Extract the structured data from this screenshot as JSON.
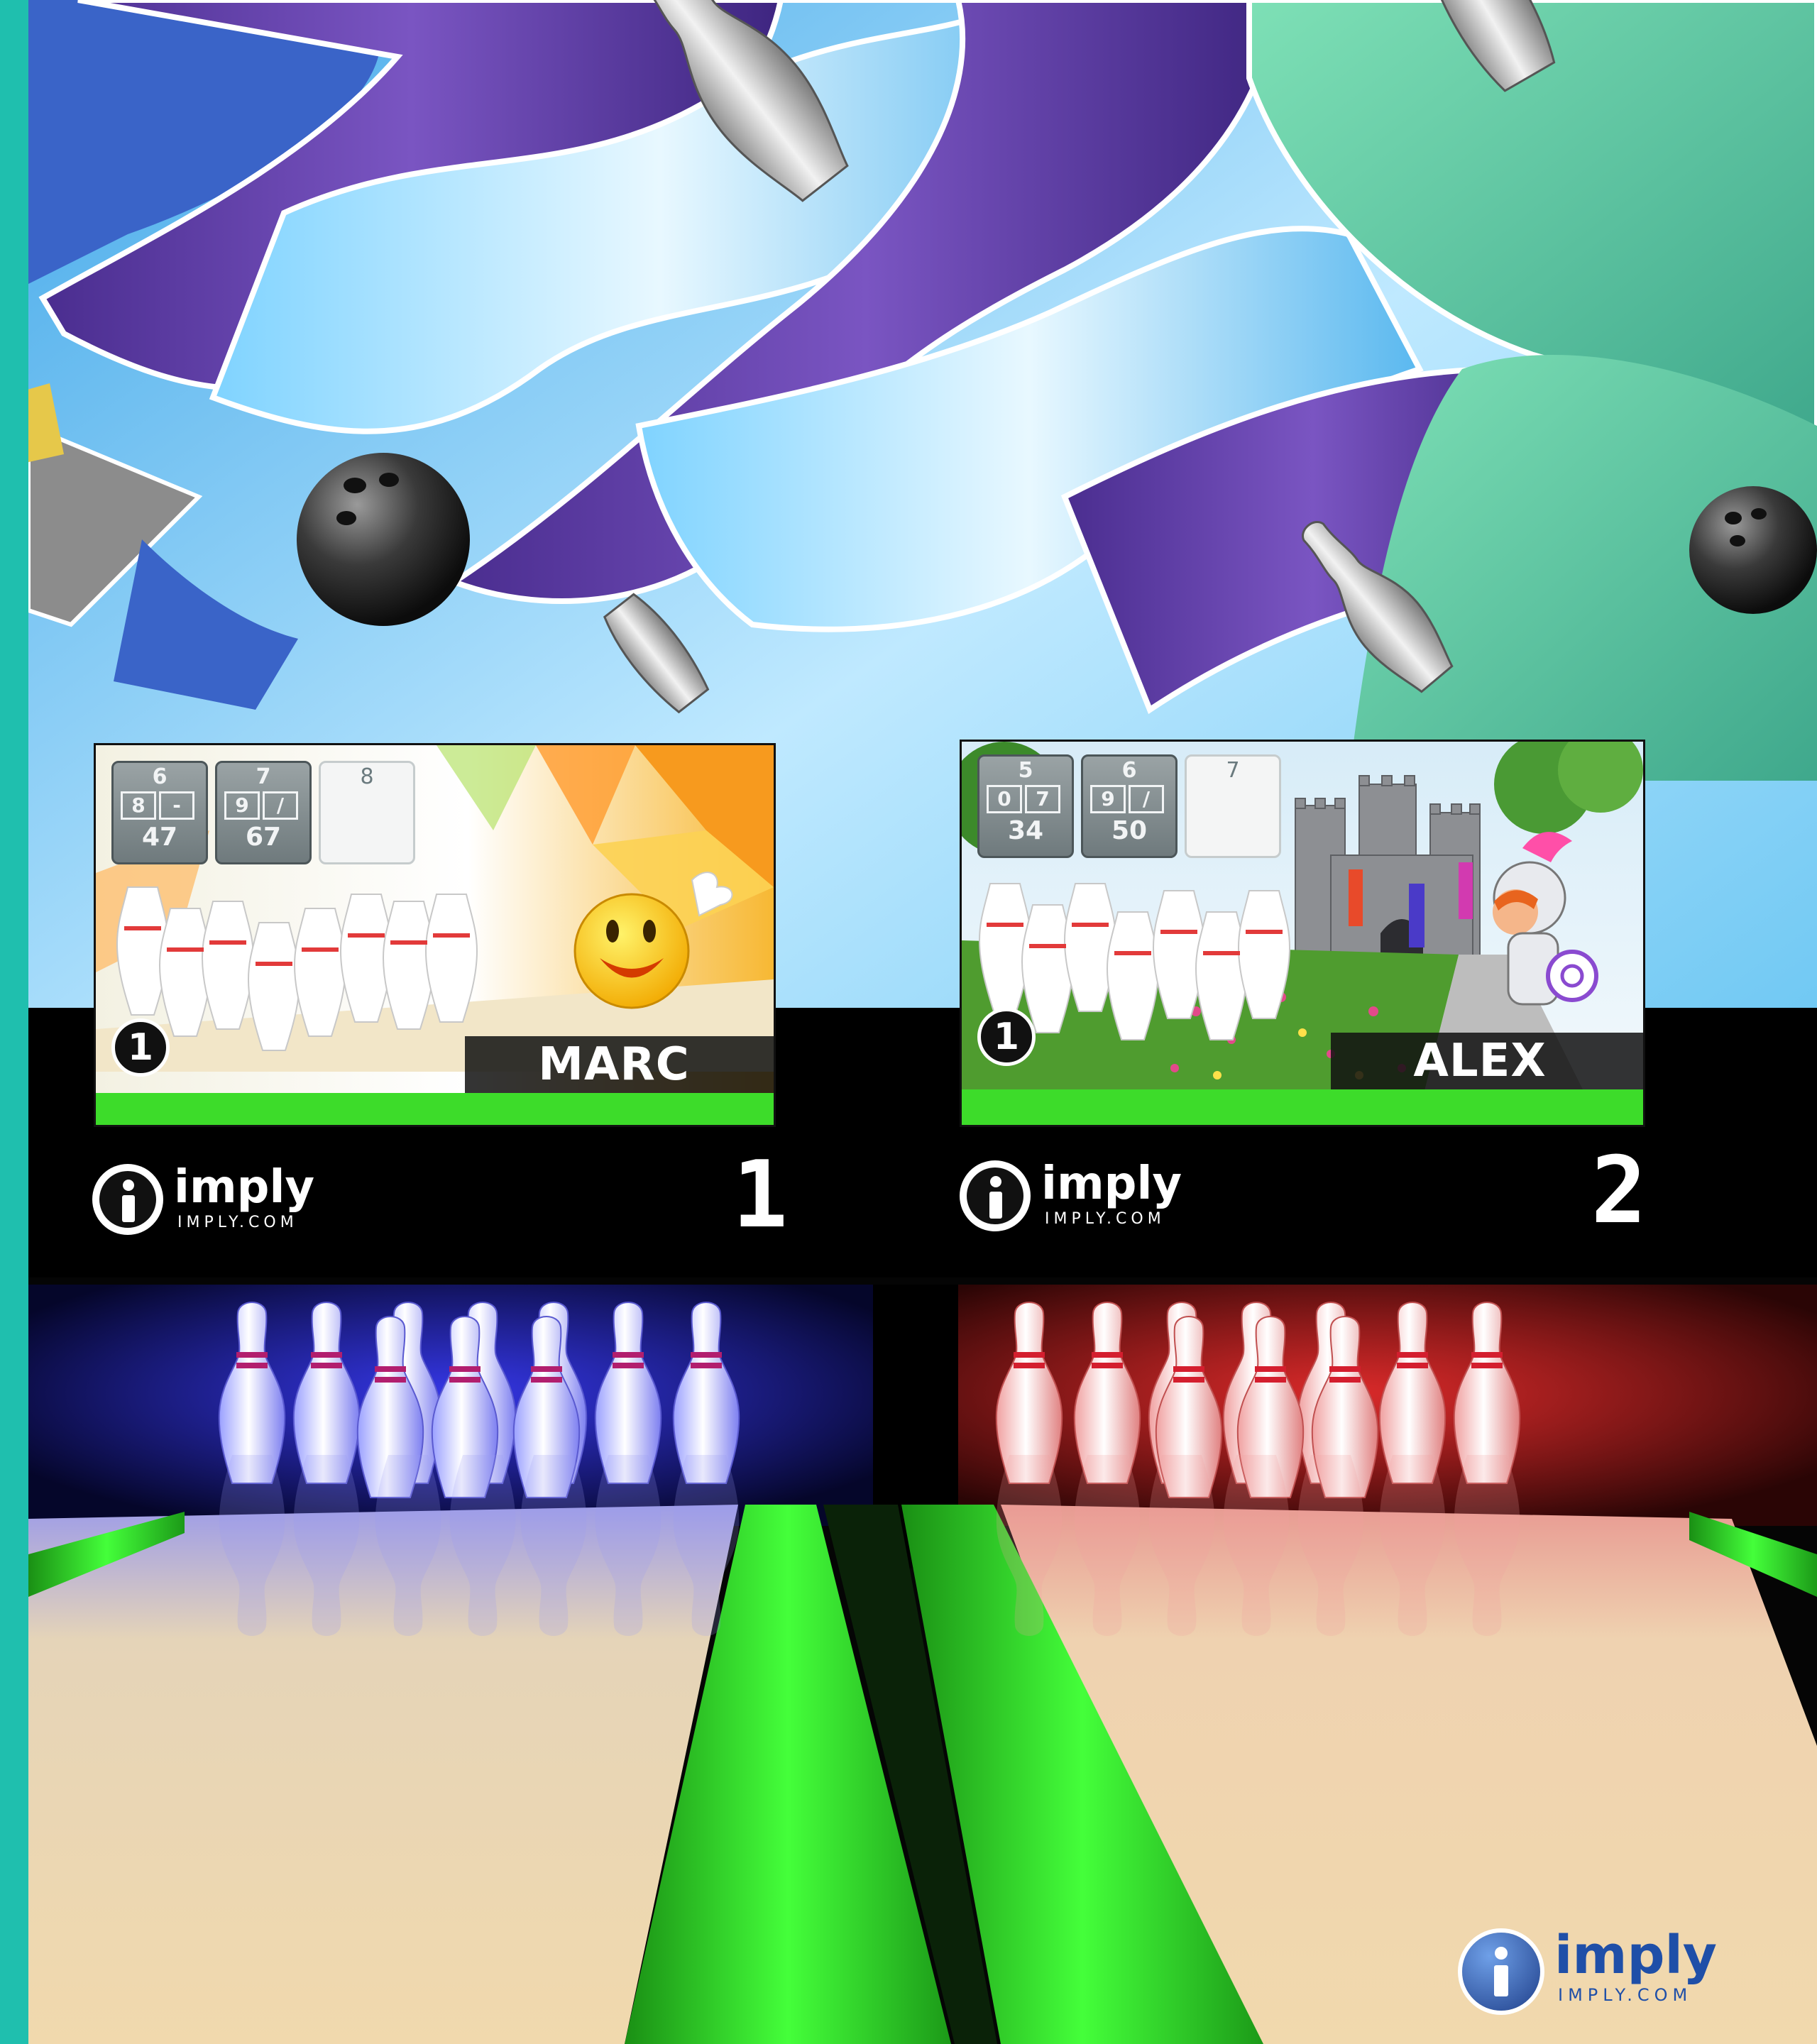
{
  "lanes": [
    {
      "lane_number": "1",
      "brand": {
        "name": "imply",
        "url": "IMPLY.COM"
      },
      "screen": {
        "player_name": "MARC",
        "player_badge": "1",
        "theme": "smiley",
        "frames": [
          {
            "frame": "6",
            "roll1": "8",
            "roll2": "-",
            "total": "47",
            "state": "completed"
          },
          {
            "frame": "7",
            "roll1": "9",
            "roll2": "/",
            "total": "67",
            "state": "completed"
          },
          {
            "frame": "8",
            "roll1": "",
            "roll2": "",
            "total": "",
            "state": "current"
          }
        ]
      },
      "lighting_color": "#2b2fff"
    },
    {
      "lane_number": "2",
      "brand": {
        "name": "imply",
        "url": "IMPLY.COM"
      },
      "screen": {
        "player_name": "ALEX",
        "player_badge": "1",
        "theme": "castle-knight",
        "frames": [
          {
            "frame": "5",
            "roll1": "0",
            "roll2": "7",
            "total": "34",
            "state": "completed"
          },
          {
            "frame": "6",
            "roll1": "9",
            "roll2": "/",
            "total": "50",
            "state": "completed"
          },
          {
            "frame": "7",
            "roll1": "",
            "roll2": "",
            "total": "",
            "state": "current"
          }
        ]
      },
      "lighting_color": "#ff2a2a"
    }
  ],
  "corner_logo": {
    "name": "imply",
    "url": "IMPLY.COM"
  },
  "colors": {
    "accent_teal": "#1fbfae",
    "screen_green": "#3ddc2a",
    "gutter_green": "#2fd629",
    "lane_wood": "#e9d2a8"
  }
}
